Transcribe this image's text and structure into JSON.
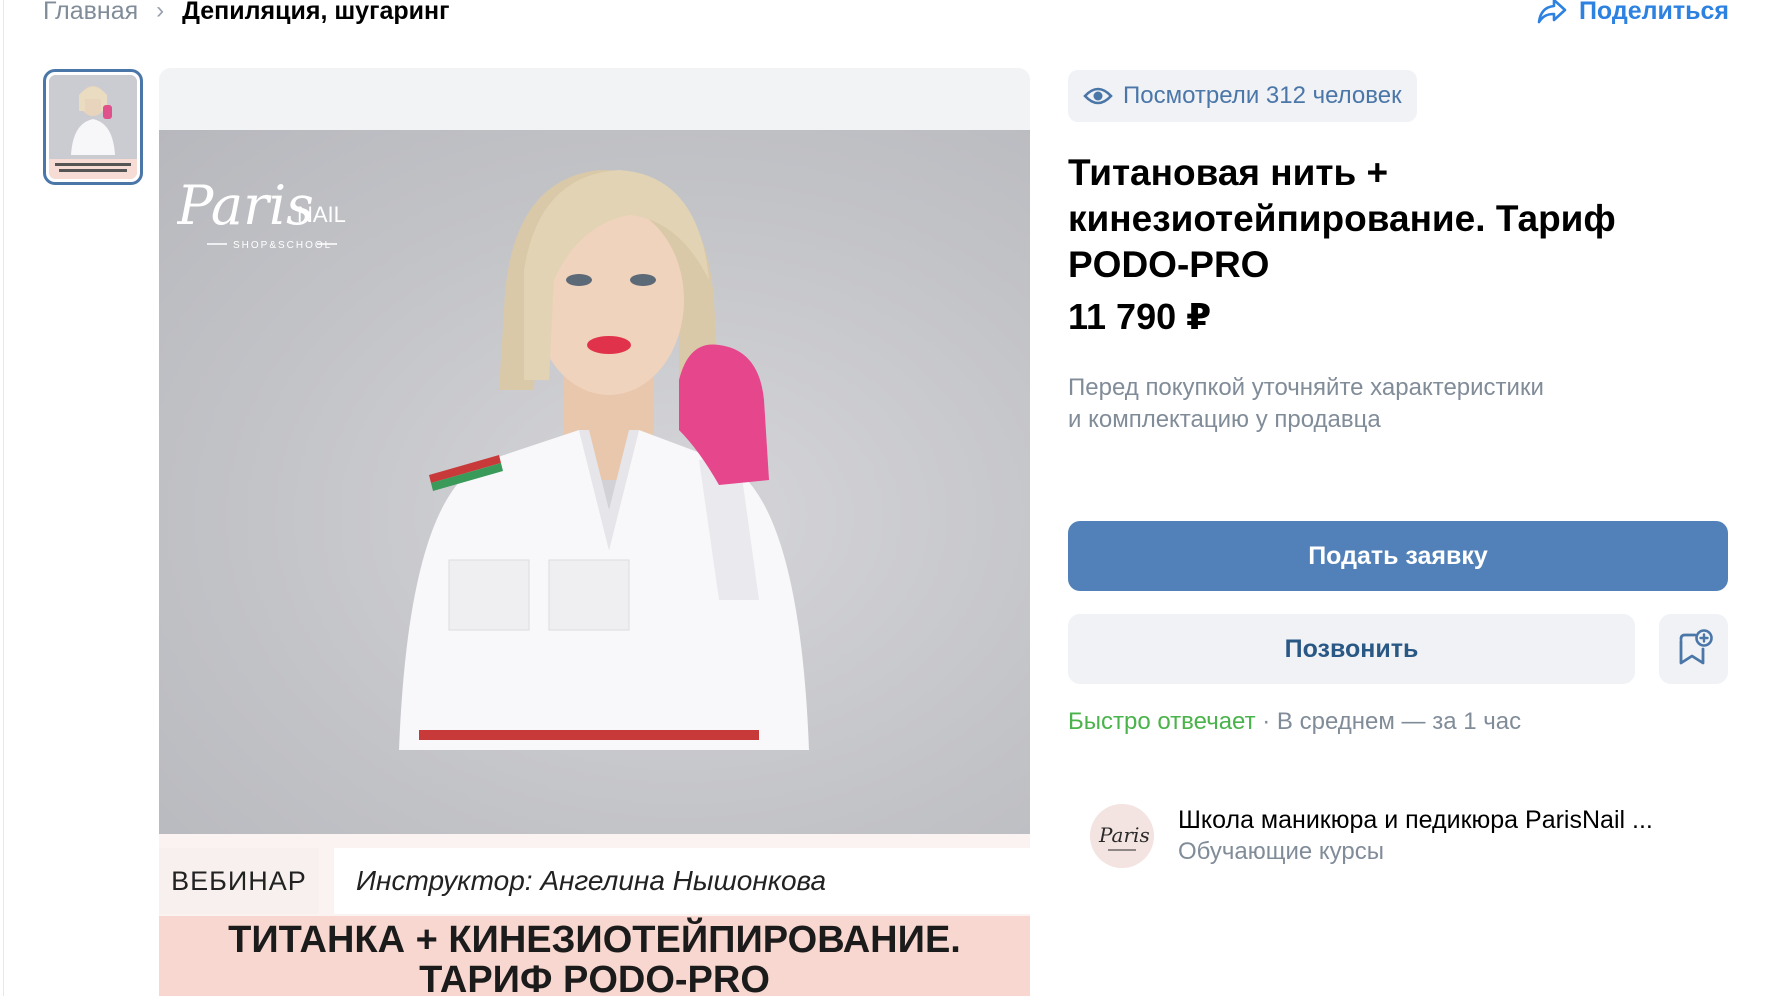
{
  "breadcrumb": {
    "home": "Главная",
    "separator": "›",
    "current": "Депиляция, шугаринг"
  },
  "share": {
    "label": "Поделиться",
    "icon": "share-icon"
  },
  "gallery": {
    "thumbnails": [
      {
        "alt": "product-photo"
      }
    ],
    "photo": {
      "brand_logo_text": "ParisNAIL",
      "brand_logo_subtext": "SHOP&SCHOOL",
      "tag": "ВЕБИНАР",
      "instructor": "Инструктор: Ангелина Нышонкова",
      "promo_title": "ТИТАНКА + КИНЕЗИОТЕЙПИРОВАНИЕ.\nТАРИФ PODO-PRO"
    }
  },
  "product": {
    "views": "Посмотрели 312 человек",
    "title": "Титановая нить + кинезиотейпирование. Тариф PODO-PRO",
    "price": "11 790 ₽",
    "note_line1": "Перед покупкой уточняйте характеристики",
    "note_line2": "и комплектацию у продавца"
  },
  "actions": {
    "apply_label": "Подать заявку",
    "call_label": "Позвонить",
    "bookmark_icon": "bookmark-add-icon"
  },
  "response": {
    "fast": "Быстро отвечает",
    "separator": " · ",
    "average": "В среднем — за 1 час"
  },
  "seller": {
    "name": "Школа маникюра и педикюра ParisNail ...",
    "category": "Обучающие курсы"
  },
  "colors": {
    "primary_button": "#5181b8",
    "link": "#2d81e0",
    "fast_response": "#4bb34b",
    "secondary_text": "#818c99"
  }
}
